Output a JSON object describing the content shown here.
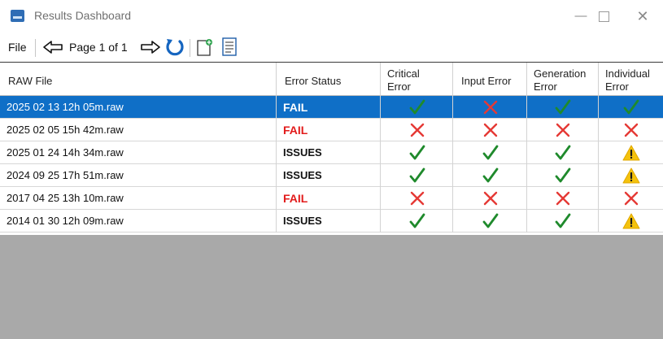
{
  "window": {
    "title": "Results Dashboard",
    "icon": "app-logo-icon",
    "controls": {
      "minimize": "—",
      "maximize": "",
      "close": "✕"
    }
  },
  "toolbar": {
    "file_label": "File",
    "page_label": "Page 1 of 1",
    "icons": [
      "previous-page-arrow-icon",
      "next-page-arrow-icon",
      "refresh-icon",
      "new-file-icon",
      "report-icon"
    ]
  },
  "columns": [
    "RAW File",
    "Error Status",
    "Critical\nError",
    "Input Error",
    "Generation\nError",
    "Individual\nError"
  ],
  "rows": [
    {
      "file": "2025 02 13 12h 05m.raw",
      "status": "FAIL",
      "critical": "pass",
      "input": "fail",
      "generation": "pass",
      "individual": "pass",
      "selected": true
    },
    {
      "file": "2025 02 05 15h 42m.raw",
      "status": "FAIL",
      "critical": "fail",
      "input": "fail",
      "generation": "fail",
      "individual": "fail",
      "selected": false
    },
    {
      "file": "2025 01 24 14h 34m.raw",
      "status": "ISSUES",
      "critical": "pass",
      "input": "pass",
      "generation": "pass",
      "individual": "warning",
      "selected": false
    },
    {
      "file": "2024 09 25 17h 51m.raw",
      "status": "ISSUES",
      "critical": "pass",
      "input": "pass",
      "generation": "pass",
      "individual": "warning",
      "selected": false
    },
    {
      "file": "2017 04 25 13h 10m.raw",
      "status": "FAIL",
      "critical": "fail",
      "input": "fail",
      "generation": "fail",
      "individual": "fail",
      "selected": false
    },
    {
      "file": "2014 01 30 12h 09m.raw",
      "status": "ISSUES",
      "critical": "pass",
      "input": "pass",
      "generation": "pass",
      "individual": "warning",
      "selected": false
    }
  ],
  "colors": {
    "selection": "#0f6fc7",
    "fail_text": "#e21b1b",
    "pass_icon": "#1f8a2c",
    "fail_icon": "#e53935",
    "warning_icon": "#f4c20d",
    "empty_area": "#a9a9a9"
  }
}
